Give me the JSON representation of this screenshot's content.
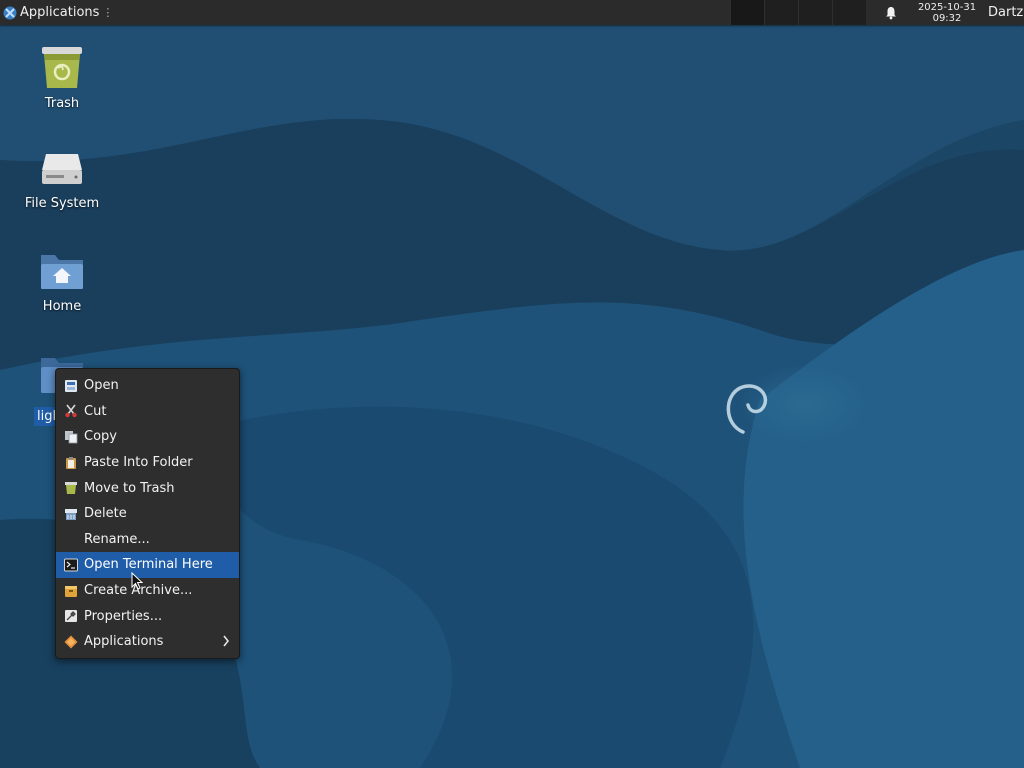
{
  "panel": {
    "applications_label": "Applications",
    "separator_glyph": "⋮",
    "clock_date": "2025-10-31",
    "clock_time": "09:32",
    "user": "Dartz"
  },
  "desktop": {
    "icons": [
      {
        "label": "Trash",
        "icon": "trash-icon"
      },
      {
        "label": "File System",
        "icon": "drive-icon"
      },
      {
        "label": "Home",
        "icon": "home-folder-icon"
      },
      {
        "label": "ligh",
        "icon": "folder-icon",
        "selected": true
      }
    ],
    "selected_label_visible": "ligl"
  },
  "context_menu": {
    "items": [
      {
        "label": "Open",
        "icon": "open-icon"
      },
      {
        "label": "Cut",
        "icon": "scissors-icon"
      },
      {
        "label": "Copy",
        "icon": "copy-icon"
      },
      {
        "label": "Paste Into Folder",
        "icon": "paste-icon"
      },
      {
        "label": "Move to Trash",
        "icon": "trash-icon"
      },
      {
        "label": "Delete",
        "icon": "delete-icon"
      },
      {
        "label": "Rename...",
        "icon": ""
      },
      {
        "label": "Open Terminal Here",
        "icon": "terminal-icon",
        "highlighted": true
      },
      {
        "label": "Create Archive...",
        "icon": "archive-icon"
      },
      {
        "label": "Properties...",
        "icon": "properties-icon"
      },
      {
        "label": "Applications",
        "icon": "applications-icon",
        "submenu": true
      }
    ]
  },
  "colors": {
    "panel": "#2b2b2b",
    "menu_bg": "#2e2e2e",
    "highlight": "#1f5da8",
    "wallpaper": "#1d4a6b"
  }
}
